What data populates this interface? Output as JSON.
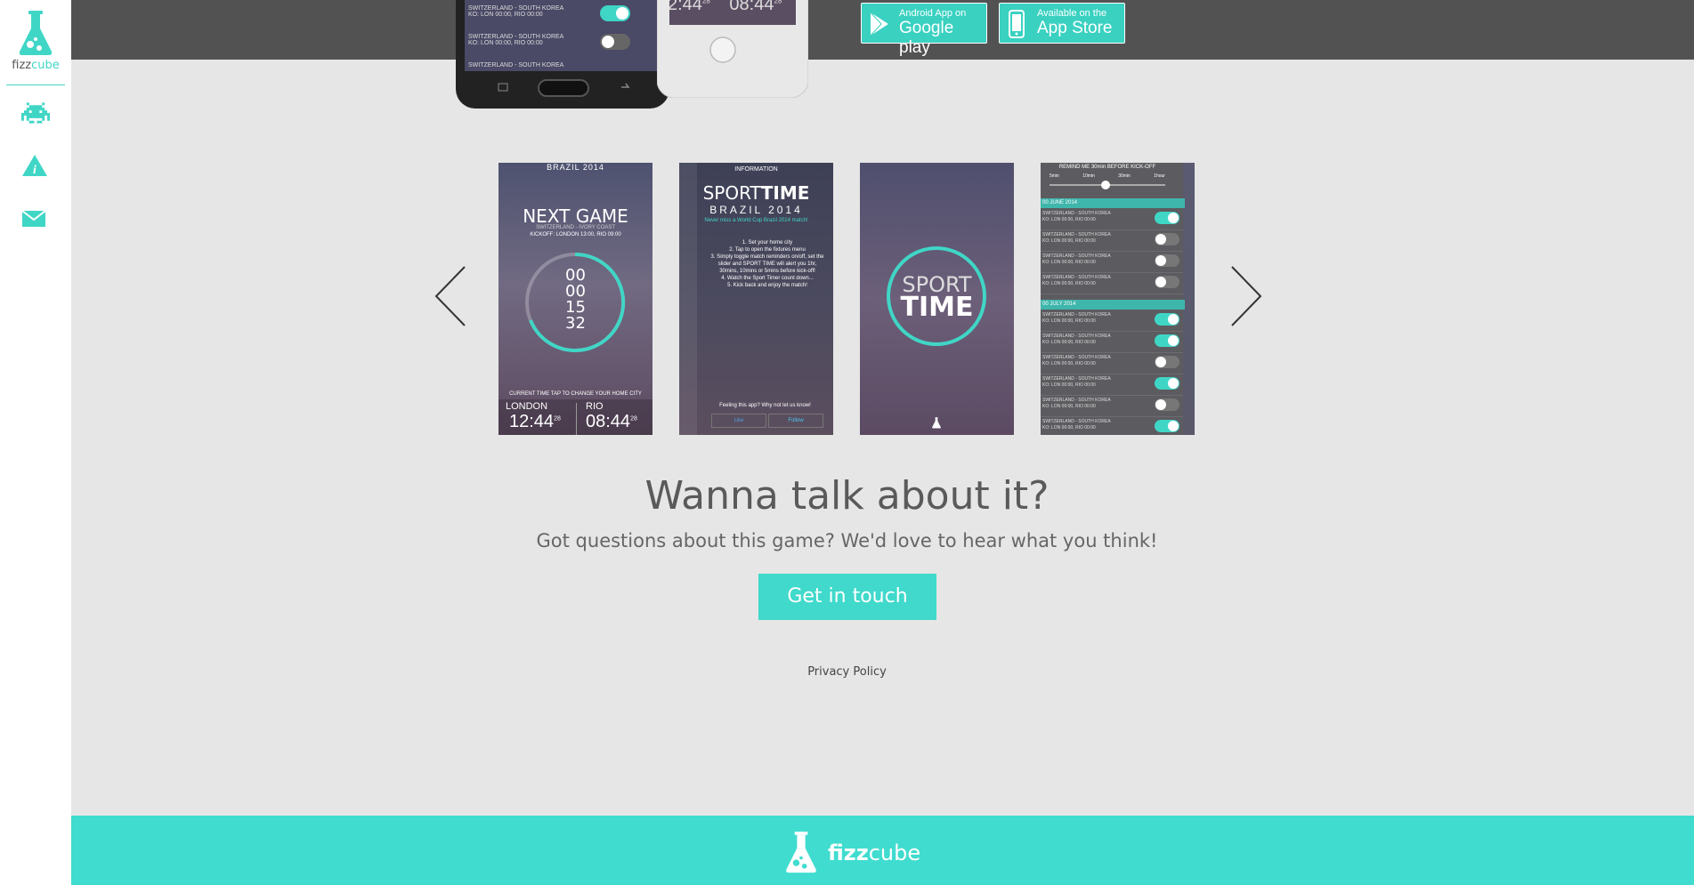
{
  "brand": {
    "name_fizz": "fizz",
    "name_cube": "cube",
    "accent": "#40d9cb",
    "dark": "#525252"
  },
  "sidebar": {
    "items": [
      {
        "icon": "space-invader-icon"
      },
      {
        "icon": "info-icon"
      },
      {
        "icon": "mail-icon"
      }
    ]
  },
  "stores": {
    "google_small": "Android App on",
    "google_big": "Google play",
    "apple_small": "Available on the",
    "apple_big": "App Store"
  },
  "phones": {
    "rows": [
      {
        "match": "SWITZERLAND - SOUTH KOREA",
        "ko": "KO: LON 00:00, RIO 00:00",
        "on": true
      },
      {
        "match": "SWITZERLAND - SOUTH KOREA",
        "ko": "KO: LON 00:00, RIO 00:00",
        "on": false
      },
      {
        "match": "SWITZERLAND - SOUTH KOREA",
        "ko": "KO: LON 00:00, RIO 00:00",
        "on": true
      }
    ],
    "time_a": "2:44",
    "time_a_sec": "28",
    "time_b": "08:44",
    "time_b_sec": "28"
  },
  "screens": {
    "s1": {
      "logo": "SPORT TIME",
      "brazil": "BRAZIL 2014",
      "next_game": "NEXT GAME",
      "teams": "SWITZERLAND - IVORY COAST",
      "kickoff": "KICKOFF: LONDON 13:00, RIO 09:00",
      "dd": "00",
      "hh": "00",
      "mm": "15",
      "ss": "32",
      "current_time": "CURRENT TIME  TAP TO CHANGE YOUR HOME CITY",
      "city1": "LONDON",
      "city2": "RIO",
      "time1": "12:44",
      "time1_sec": "28",
      "time2": "08:44",
      "time2_sec": "28"
    },
    "s2": {
      "header": "INFORMATION",
      "logo_a": "SPORT",
      "logo_b": "TIME",
      "brazil": "BRAZIL 2014",
      "tagline": "Never miss a World Cup Brazil 2014 match!",
      "steps": [
        "1. Set your home city",
        "2. Tap to open the fixtures menu",
        "3. Simply toggle match reminders on/off, set the slider and SPORT TIME will alert you 1hr, 30mins, 10mins or 5mins before kick-off!",
        "4. Watch the Sport Timer count down...",
        "5. Kick back and enjoy the match!"
      ],
      "feeling": "Feeling this app?  Why not let us know!",
      "like": "Like",
      "follow": "Follow"
    },
    "s3": {
      "logo_a": "SPORT",
      "logo_b": "TIME"
    },
    "s4": {
      "remind": "REMIND ME 30min BEFORE KICK-OFF",
      "opts": [
        "5min",
        "10min",
        "30min",
        "1hour"
      ],
      "date1": "00 JUNE 2014",
      "date2": "00 JULY 2014",
      "row_match": "SWITZERLAND - SOUTH KOREA",
      "row_ko": "KO: LON 00:00, RIO 00:00",
      "rows1": [
        true,
        false,
        false,
        false
      ],
      "rows2": [
        true,
        true,
        false,
        true,
        false,
        true
      ]
    }
  },
  "cta": {
    "title": "Wanna talk about it?",
    "subtitle": "Got questions about this game? We'd love to hear what you think!",
    "button": "Get in touch",
    "privacy": "Privacy Policy"
  },
  "footer": {
    "fizz": "fizz",
    "cube": "cube"
  }
}
